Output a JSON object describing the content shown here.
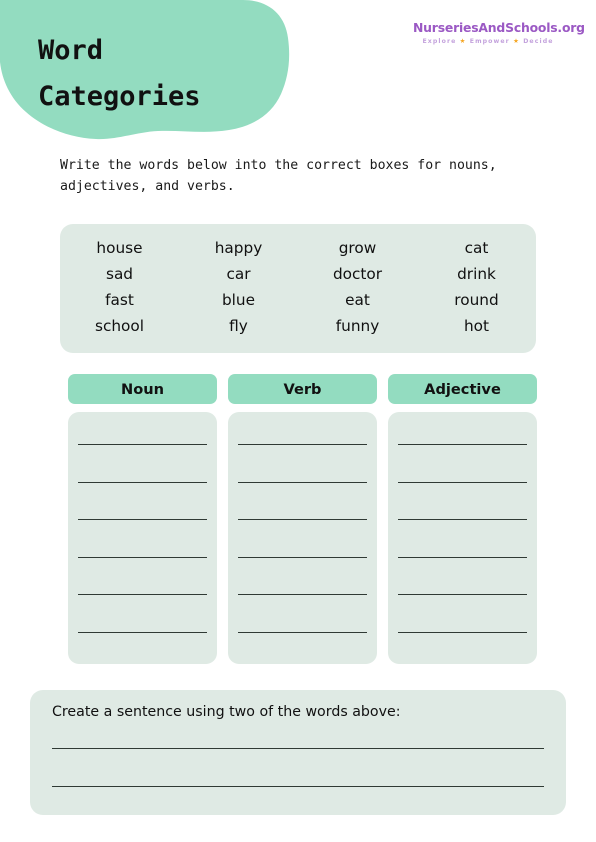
{
  "header": {
    "title": "Word\nCategories",
    "blob_color": "#93dcc0"
  },
  "logo": {
    "wordmark": "NurseriesAndSchools.org",
    "tagline_part1": "Explore",
    "tagline_part2": "Empower",
    "tagline_part3": "Decide",
    "star_glyph": "★",
    "wordmark_color": "#9b59c4",
    "tagline_color": "#c4a3dd",
    "star_color": "#f5a623"
  },
  "instructions": {
    "text": "Write the words below into the correct boxes for nouns, adjectives, and verbs."
  },
  "word_bank": {
    "background_color": "#dfeae4",
    "columns": [
      [
        "house",
        "sad",
        "fast",
        "school"
      ],
      [
        "happy",
        "car",
        "blue",
        "fly"
      ],
      [
        "grow",
        "doctor",
        "eat",
        "funny"
      ],
      [
        "cat",
        "drink",
        "round",
        "hot"
      ]
    ]
  },
  "categories": [
    {
      "label": "Noun",
      "lines": 6
    },
    {
      "label": "Verb",
      "lines": 6
    },
    {
      "label": "Adjective",
      "lines": 6
    }
  ],
  "sentence_section": {
    "prompt": "Create a sentence using two of the words above:",
    "lines": 2,
    "background_color": "#dfeae4"
  },
  "colors": {
    "mint_strong": "#93dcc0",
    "mint_light": "#dfeae4",
    "ink": "#111111",
    "rule": "#2f3a34",
    "page": "#ffffff"
  }
}
